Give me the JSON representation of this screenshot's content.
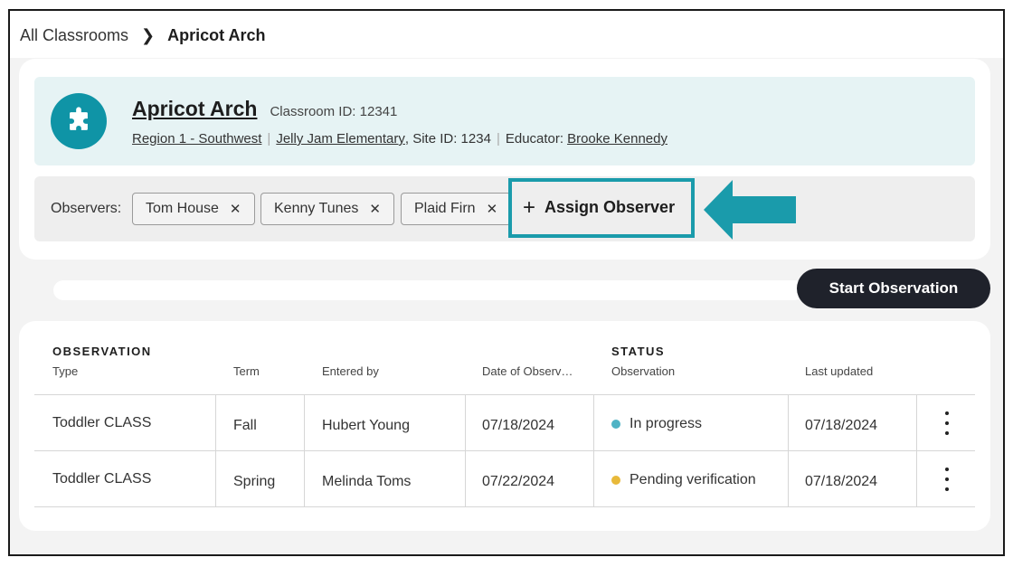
{
  "breadcrumb": {
    "parent": "All Classrooms",
    "current": "Apricot Arch"
  },
  "classroom": {
    "name": "Apricot Arch",
    "id_text": "Classroom ID: 12341",
    "region": "Region 1 - Southwest",
    "school": "Jelly Jam Elementary",
    "site_text": ", Site ID: 1234",
    "educator_label": "Educator:",
    "educator": "Brooke Kennedy",
    "icon": "puzzle-icon"
  },
  "observers": {
    "label": "Observers:",
    "items": [
      "Tom House",
      "Kenny Tunes",
      "Plaid Firn"
    ],
    "remove_glyph": "✕",
    "assign_plus": "+",
    "assign_label": "Assign Observer"
  },
  "actions": {
    "start_observation": "Start Observation"
  },
  "table": {
    "groups": {
      "observation": "OBSERVATION",
      "status": "STATUS"
    },
    "columns": [
      "Type",
      "Term",
      "Entered by",
      "Date of Observ…",
      "Observation",
      "Last updated"
    ],
    "rows": [
      {
        "type": "Toddler CLASS",
        "term": "Fall",
        "entered_by": "Hubert Young",
        "date": "07/18/2024",
        "status": "In progress",
        "status_color": "#4fb3c5",
        "updated": "07/18/2024"
      },
      {
        "type": "Toddler CLASS",
        "term": "Spring",
        "entered_by": "Melinda Toms",
        "date": "07/22/2024",
        "status": "Pending verification",
        "status_color": "#e8b93a",
        "updated": "07/18/2024"
      }
    ]
  },
  "colors": {
    "accent": "#1a9bab",
    "icon_bg": "#0f94a6",
    "button_dark": "#1f222b"
  }
}
